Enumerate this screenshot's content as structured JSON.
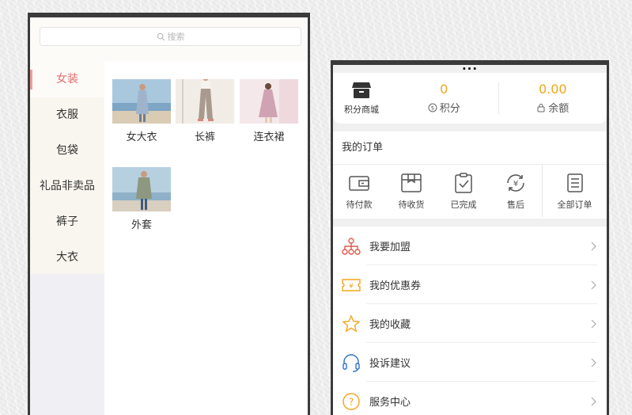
{
  "category_screen": {
    "search": {
      "placeholder": "搜索"
    },
    "categories": [
      {
        "label": "女装",
        "active": true
      },
      {
        "label": "衣服",
        "active": false
      },
      {
        "label": "包袋",
        "active": false
      },
      {
        "label": "礼品非卖品",
        "active": false
      },
      {
        "label": "裤子",
        "active": false
      },
      {
        "label": "大衣",
        "active": false
      }
    ],
    "products": [
      {
        "name": "女大衣"
      },
      {
        "name": "长裤"
      },
      {
        "name": "连衣裙"
      },
      {
        "name": "外套"
      }
    ]
  },
  "profile_screen": {
    "clipped_header": "...",
    "shop_entry": {
      "label": "积分商城",
      "icon": "shop-icon"
    },
    "points": {
      "value": "0",
      "label": "积分",
      "icon": "coin-icon"
    },
    "balance": {
      "value": "0.00",
      "label": "余额",
      "icon": "lock-icon"
    },
    "orders": {
      "title": "我的订单",
      "items": [
        {
          "label": "待付款",
          "icon": "wallet-icon"
        },
        {
          "label": "待收货",
          "icon": "package-icon"
        },
        {
          "label": "已完成",
          "icon": "clipboard-check-icon"
        },
        {
          "label": "售后",
          "icon": "refresh-yen-icon"
        },
        {
          "label": "全部订单",
          "icon": "list-icon"
        }
      ]
    },
    "menu": [
      {
        "label": "我要加盟",
        "icon": "network-icon"
      },
      {
        "label": "我的优惠券",
        "icon": "coupon-icon"
      },
      {
        "label": "我的收藏",
        "icon": "star-icon"
      },
      {
        "label": "投诉建议",
        "icon": "headset-icon"
      },
      {
        "label": "服务中心",
        "icon": "question-icon"
      }
    ]
  },
  "colors": {
    "accent_orange": "#f4a51c",
    "active_category": "#e26d6d",
    "menu_icon_red": "#e05a4a",
    "menu_icon_orange": "#f4a51c",
    "menu_icon_blue": "#2f72c9"
  }
}
